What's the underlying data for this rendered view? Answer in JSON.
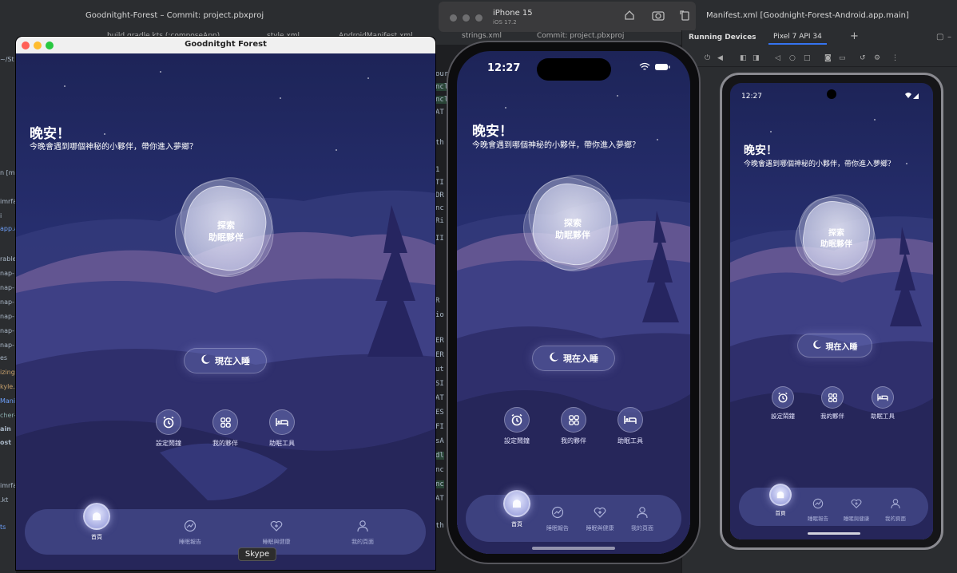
{
  "ide": {
    "window_title_left": "Goodnitght-Forest – Commit: project.pbxproj",
    "window_title_right": "Manifest.xml [Goodnight-Forest-Android.app.main]",
    "tabs": [
      "build.gradle.kts (:composeApp)",
      "style.xml",
      "AndroidManifest.xml",
      "strings.xml",
      "Commit: project.pbxproj"
    ],
    "left_strip": [
      "~/St",
      "n [m",
      "imrfa",
      "i",
      "app.a",
      "rable",
      "nap-",
      "nap-",
      "nap-",
      "nap-",
      "nap-",
      "nap-",
      "es",
      "izing",
      "kyle.x",
      "Manif",
      "cher-",
      "ain",
      "ost",
      "imrfa",
      ".kt",
      "ts"
    ],
    "code_strip": [
      "our",
      "ncl",
      "ncl",
      "AT",
      "th",
      "1",
      "TI",
      "DR",
      "nc",
      "Ri",
      "II",
      "R",
      "io",
      "ER",
      "ER",
      "ut",
      "SI",
      "AT",
      "ES",
      "FI",
      "sA",
      "dl",
      "nc",
      "nc",
      "AT",
      "th"
    ]
  },
  "simulator": {
    "device_name": "iPhone 15",
    "os_version": "iOS 17.2",
    "home_icon": "home-icon",
    "screenshot_icon": "camera-icon",
    "rotate_icon": "rotate-icon"
  },
  "running_devices": {
    "header": "Running Devices",
    "device_tab": "Pixel 7 API 34",
    "add_label": "+"
  },
  "mac_app": {
    "title": "Goodnitght Forest",
    "tooltip": "Skype"
  },
  "app": {
    "greeting": "晚安！",
    "subtitle": "今晚會遇到哪個神秘的小夥伴，帶你進入夢鄉？",
    "explore_line1": "探索",
    "explore_line2": "助眠夥伴",
    "sleep_now": "現在入睡",
    "quick_actions": [
      {
        "label": "設定鬧鐘",
        "icon": "alarm-clock-icon"
      },
      {
        "label": "我的夥伴",
        "icon": "grid-icon"
      },
      {
        "label": "助眠工具",
        "icon": "bed-icon"
      }
    ],
    "tabs": [
      {
        "label": "首頁",
        "icon": "home-icon"
      },
      {
        "label": "睡眠報告",
        "icon": "chart-icon"
      },
      {
        "label": "睡眠與健康",
        "icon": "heart-plus-icon"
      },
      {
        "label": "我的頁面",
        "icon": "person-icon"
      }
    ]
  },
  "ios_status": {
    "time": "12:27",
    "icons": "wifi-battery-icons"
  },
  "android_status": {
    "time": "12:27",
    "icons": "wifi-signal-icons"
  },
  "colors": {
    "accent": "#3574f0",
    "scene_top": "#1d2458",
    "scene_bottom": "#262758"
  }
}
